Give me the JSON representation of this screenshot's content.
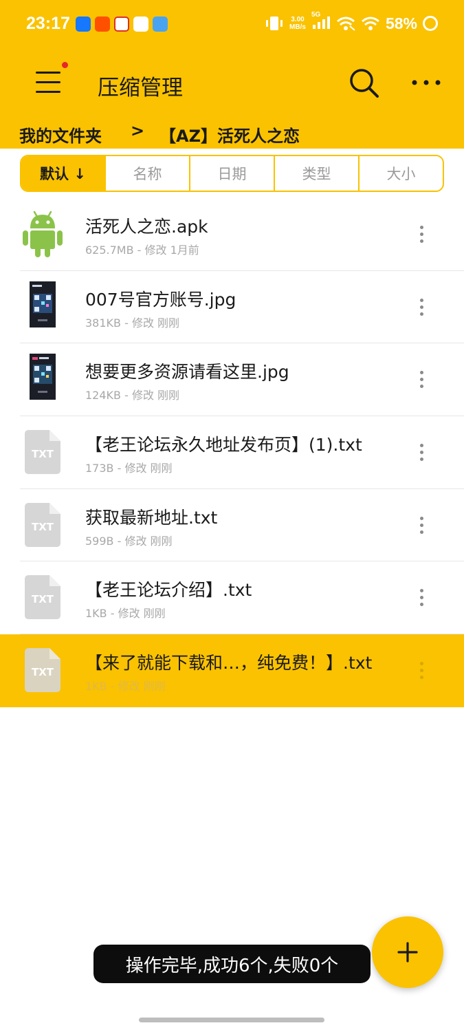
{
  "status_bar": {
    "time": "23:17",
    "net_speed_value": "3.00",
    "net_speed_unit": "MB/s",
    "network_type": "5G",
    "battery": "58%",
    "app_icons": [
      "alipay-icon",
      "taobao-icon",
      "pdd-icon",
      "telegram-icon",
      "app-icon"
    ]
  },
  "toolbar": {
    "title": "压缩管理",
    "menu_icon": "hamburger-menu-icon",
    "search_icon": "search-icon",
    "more_icon": "more-horizontal-icon"
  },
  "breadcrumb": {
    "home": "我的文件夹",
    "separator": ">",
    "current": "【AZ】活死人之恋"
  },
  "sort_tabs": [
    {
      "label": "默认 ↓",
      "active": true
    },
    {
      "label": "名称",
      "active": false
    },
    {
      "label": "日期",
      "active": false
    },
    {
      "label": "类型",
      "active": false
    },
    {
      "label": "大小",
      "active": false
    }
  ],
  "files": [
    {
      "name": "活死人之恋.apk",
      "meta": "625.7MB - 修改 1月前",
      "type": "apk"
    },
    {
      "name": "007号官方账号.jpg",
      "meta": "381KB - 修改 刚刚",
      "type": "jpg"
    },
    {
      "name": "想要更多资源请看这里.jpg",
      "meta": "124KB - 修改 刚刚",
      "type": "jpg"
    },
    {
      "name": "【老王论坛永久地址发布页】(1).txt",
      "meta": "173B - 修改 刚刚",
      "type": "txt"
    },
    {
      "name": "获取最新地址.txt",
      "meta": "599B - 修改 刚刚",
      "type": "txt"
    },
    {
      "name": "【老王论坛介绍】.txt",
      "meta": "1KB - 修改 刚刚",
      "type": "txt"
    },
    {
      "name": "【来了就能下载和…，纯免费！】.txt",
      "meta": "1KB - 修改 刚刚",
      "type": "txt",
      "selected": true
    }
  ],
  "txt_icon_label": "TXT",
  "toast": "操作完毕,成功6个,失败0个",
  "fab_icon": "plus-icon",
  "colors": {
    "accent": "#FAC200",
    "text_primary": "#1a1a1a",
    "text_secondary": "#a8a8a8",
    "android_green": "#8BC34A"
  }
}
